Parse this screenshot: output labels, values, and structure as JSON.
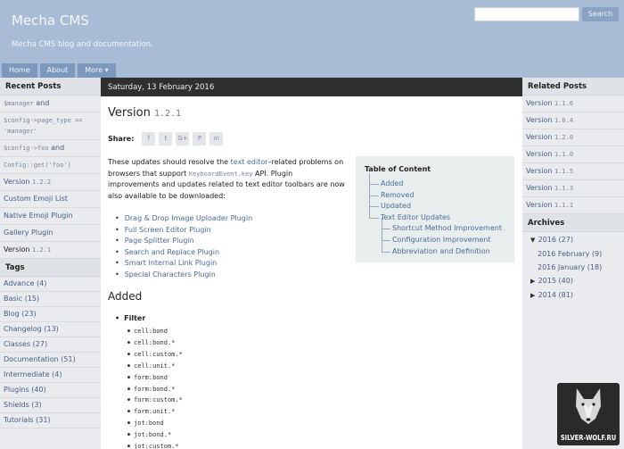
{
  "header": {
    "title": "Mecha CMS",
    "description": "Mecha CMS blog and documentation.",
    "search_placeholder": "",
    "search_button": "Search",
    "nav": [
      "Home",
      "About",
      "More ▾"
    ]
  },
  "left_sidebar": {
    "recent_heading": "Recent Posts",
    "recent": [
      {
        "pre": "",
        "code": "$manager",
        "post": " and"
      },
      {
        "pre": "",
        "code": "$config->page_type == 'manager'",
        "post": ""
      },
      {
        "pre": "",
        "code": "$config->foo",
        "post": " and"
      },
      {
        "pre": "",
        "code": "Config::get('foo')",
        "post": ""
      },
      {
        "pre": "Version ",
        "code": "1.2.2",
        "post": ""
      },
      {
        "pre": "Custom Emoji List",
        "code": "",
        "post": ""
      },
      {
        "pre": "Native Emoji Plugin",
        "code": "",
        "post": ""
      },
      {
        "pre": "Gallery Plugin",
        "code": "",
        "post": ""
      },
      {
        "pre": "Version ",
        "code": "1.2.1",
        "post": ""
      }
    ],
    "tags_heading": "Tags",
    "tags": [
      "Advance (4)",
      "Basic (15)",
      "Blog (23)",
      "Changelog (13)",
      "Classes (27)",
      "Documentation (51)",
      "Intermediate (4)",
      "Plugins (40)",
      "Shields (3)",
      "Tutorials (31)"
    ]
  },
  "main": {
    "date": "Saturday, 13 February 2016",
    "title": "Version",
    "title_code": "1.2.1",
    "share_label": "Share:",
    "share_icons": [
      "f",
      "t",
      "G+",
      "P",
      "in"
    ],
    "intro_1": "These updates should resolve the ",
    "intro_link": "text editor",
    "intro_2": "–related problems on browsers that support ",
    "intro_code": "KeyboardEvent.key",
    "intro_3": " API. Plugin improvements and updates related to text editor toolbars are now also available to be downloaded:",
    "plugins": [
      "Drag & Drop Image Uploader Plugin",
      "Full Screen Editor Plugin",
      "Page Splitter Plugin",
      "Search and Replace Plugin",
      "Smart Internal Link Plugin",
      "Special Characters Plugin"
    ],
    "toc_title": "Table of Content",
    "toc": [
      {
        "label": "Added",
        "level": 1
      },
      {
        "label": "Removed",
        "level": 1
      },
      {
        "label": "Updated",
        "level": 1
      },
      {
        "label": "Text Editor Updates",
        "level": 1
      },
      {
        "label": "Shortcut Method Improvement",
        "level": 2
      },
      {
        "label": "Configuration Improvement",
        "level": 2
      },
      {
        "label": "Abbreviation and Definition",
        "level": 2
      }
    ],
    "added_heading": "Added",
    "filter_label": "Filter",
    "filters": [
      "cell:bond",
      "cell:bond.*",
      "cell:custom.*",
      "cell:unit.*",
      "form:bond",
      "form:bond.*",
      "form:custom.*",
      "form:unit.*",
      "jot:bond",
      "jot:bond.*",
      "jot:custom.*"
    ]
  },
  "right_sidebar": {
    "related_heading": "Related Posts",
    "related": [
      "1.1.6",
      "1.0.4",
      "1.2.0",
      "1.1.0",
      "1.1.5",
      "1.1.3",
      "1.1.1"
    ],
    "related_prefix": "Version ",
    "archives_heading": "Archives",
    "archives": [
      {
        "label": "2016 (27)",
        "arrow": "▼",
        "sub": false
      },
      {
        "label": "2016 February (9)",
        "arrow": "",
        "sub": true
      },
      {
        "label": "2016 January (18)",
        "arrow": "",
        "sub": true
      },
      {
        "label": "2015 (40)",
        "arrow": "▶",
        "sub": false
      },
      {
        "label": "2014 (81)",
        "arrow": "▶",
        "sub": false
      }
    ]
  },
  "watermark": "SILVER-WOLF.RU"
}
